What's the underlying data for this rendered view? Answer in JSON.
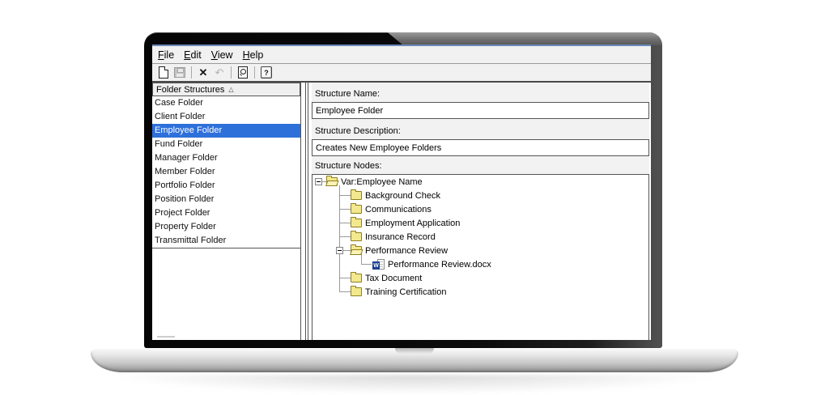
{
  "menu": {
    "items": [
      {
        "key": "F",
        "rest": "ile"
      },
      {
        "key": "E",
        "rest": "dit"
      },
      {
        "key": "V",
        "rest": "iew"
      },
      {
        "key": "H",
        "rest": "elp"
      }
    ]
  },
  "toolbar": {
    "icons": [
      "new-document",
      "save",
      "delete",
      "undo",
      "print-preview",
      "help"
    ],
    "delete_glyph": "✕",
    "undo_glyph": "↶",
    "help_glyph": "?"
  },
  "sidebar": {
    "header": "Folder Structures",
    "sort_indicator": "△",
    "selected_index": 2,
    "items": [
      "Case Folder",
      "Client Folder",
      "Employee Folder",
      "Fund Folder",
      "Manager Folder",
      "Member Folder",
      "Portfolio Folder",
      "Position Folder",
      "Project Folder",
      "Property Folder",
      "Transmittal Folder"
    ]
  },
  "form": {
    "name_label": "Structure Name:",
    "name_value": "Employee Folder",
    "desc_label": "Structure Description:",
    "desc_value": "Creates New Employee Folders",
    "nodes_label": "Structure Nodes:"
  },
  "tree": {
    "file_badge": "W",
    "nodes": [
      {
        "label": "Var:Employee Name",
        "type": "folder-open",
        "depth": 0,
        "expanded": true
      },
      {
        "label": "Background Check",
        "type": "folder",
        "depth": 1
      },
      {
        "label": "Communications",
        "type": "folder",
        "depth": 1
      },
      {
        "label": "Employment Application",
        "type": "folder",
        "depth": 1
      },
      {
        "label": "Insurance Record",
        "type": "folder",
        "depth": 1
      },
      {
        "label": "Performance Review",
        "type": "folder-open",
        "depth": 1,
        "expanded": true
      },
      {
        "label": "Performance Review.docx",
        "type": "file-docx",
        "depth": 2
      },
      {
        "label": "Tax Document",
        "type": "folder",
        "depth": 1
      },
      {
        "label": "Training Certification",
        "type": "folder",
        "depth": 1
      }
    ]
  },
  "colors": {
    "selection_blue": "#2e70da",
    "window_border_blue": "#6d8cba",
    "chrome_gray": "#f1f1f1",
    "folder_yellow": "#f4e88e",
    "docx_blue": "#1b3f8f"
  }
}
